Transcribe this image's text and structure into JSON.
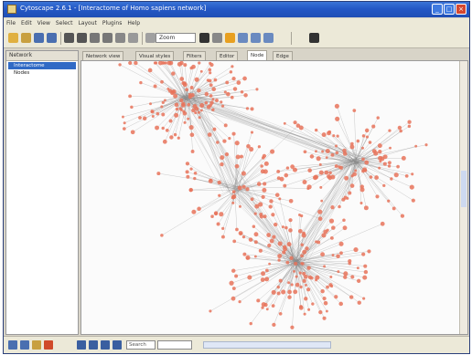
{
  "window": {
    "title": "Cytoscape 2.6.1 - [Interactome of Homo sapiens network]"
  },
  "menubar": {
    "items": [
      "File",
      "Edit",
      "View",
      "Select",
      "Layout",
      "Plugins",
      "Help"
    ]
  },
  "toolbar": {
    "zoom_value": "Zoom"
  },
  "sidebar": {
    "header": "Network",
    "items": [
      {
        "label": "Interactome",
        "selected": true
      },
      {
        "label": "Nodes",
        "selected": false
      }
    ]
  },
  "tabs": [
    {
      "label": "Network view",
      "active": false
    },
    {
      "label": "Visual styles",
      "active": false
    },
    {
      "label": "Filters",
      "active": false
    },
    {
      "label": "Editor",
      "active": false
    },
    {
      "label": "Node",
      "active": true
    },
    {
      "label": "Edge",
      "active": false
    }
  ],
  "statusbar": {
    "search_placeholder": "Search"
  },
  "colors": {
    "node": "#e8735a",
    "edge": "#8a8a8a",
    "titlebar": "#2458c6",
    "selection": "#316ac5"
  }
}
